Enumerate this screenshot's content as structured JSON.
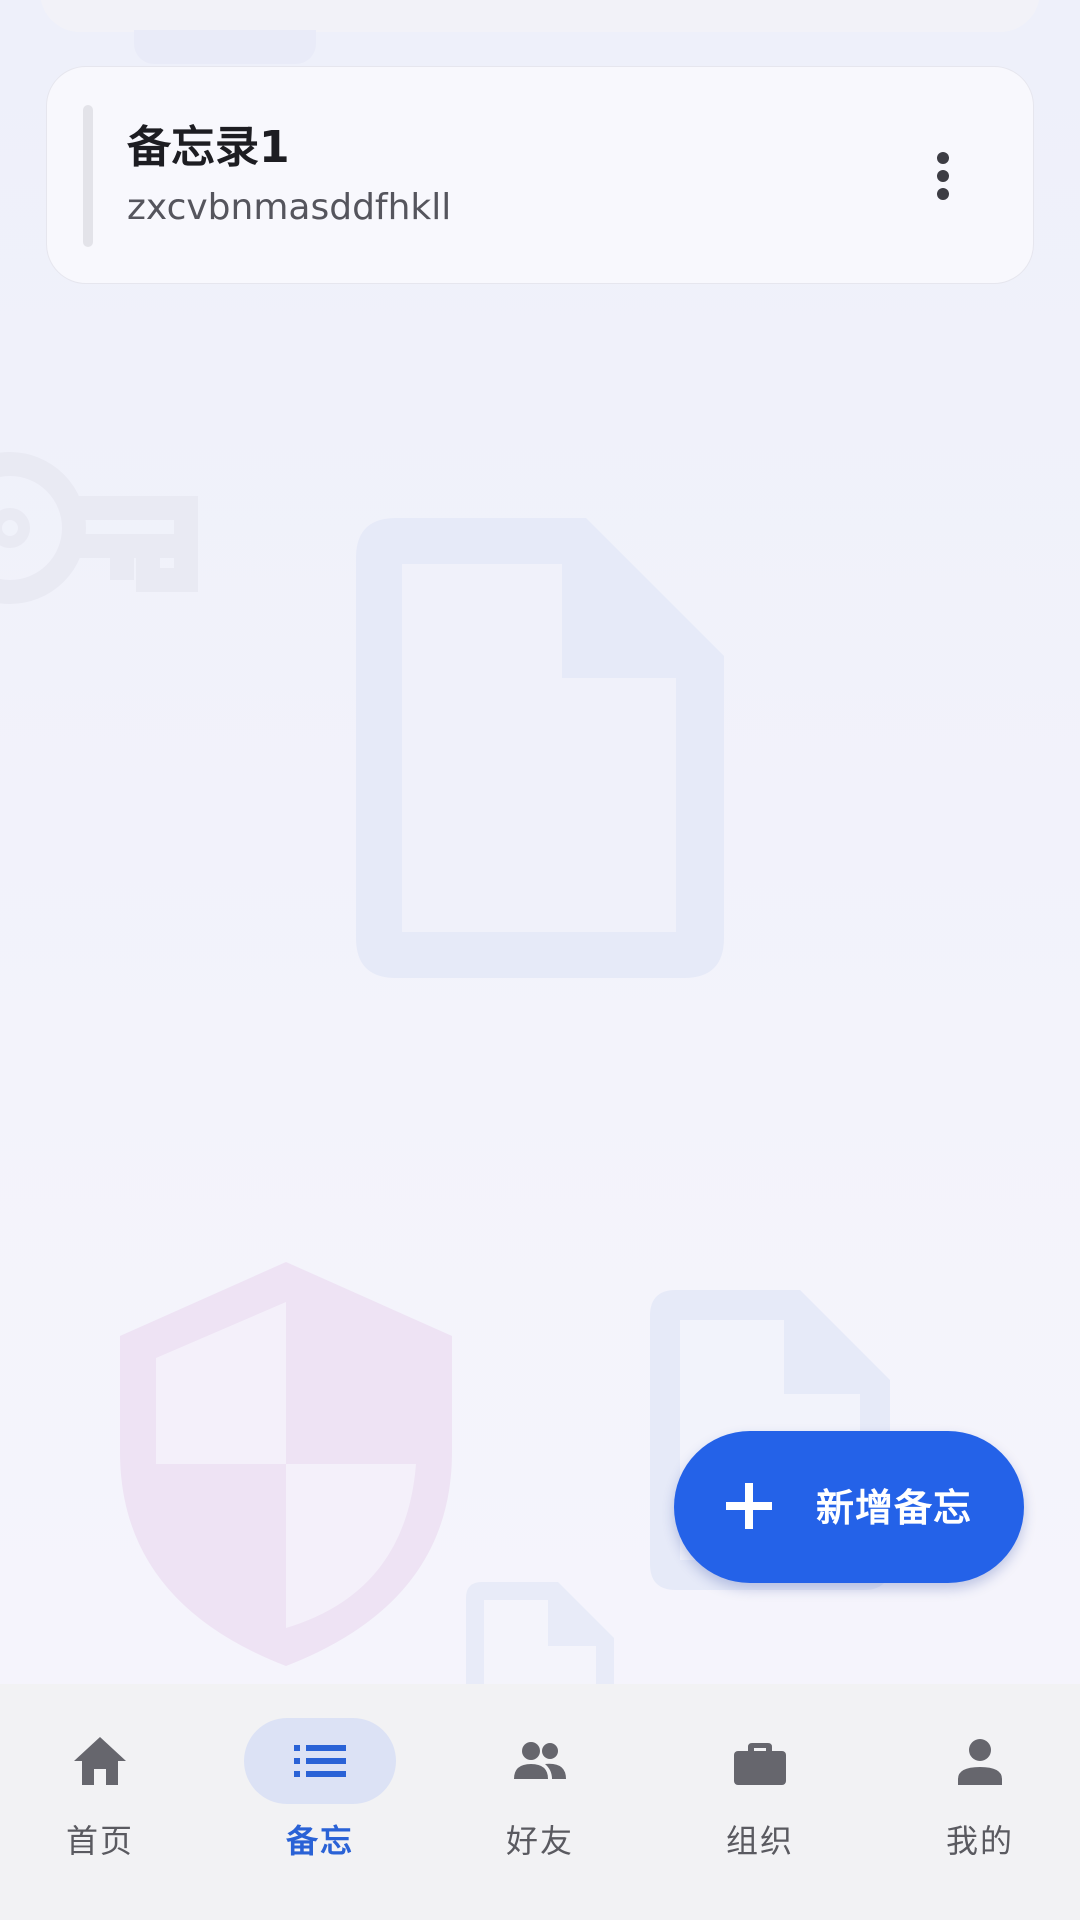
{
  "memo_list": {
    "items": [
      {
        "title": "备忘录1",
        "preview": "zxcvbnmasddfhkll",
        "more_icon": "more-vertical-icon"
      }
    ]
  },
  "fab": {
    "label": "新增备忘",
    "icon": "plus-icon"
  },
  "bottom_nav": {
    "items": [
      {
        "label": "首页",
        "icon": "home-icon",
        "active": false
      },
      {
        "label": "备忘",
        "icon": "list-icon",
        "active": true
      },
      {
        "label": "好友",
        "icon": "people-icon",
        "active": false
      },
      {
        "label": "组织",
        "icon": "briefcase-icon",
        "active": false
      },
      {
        "label": "我的",
        "icon": "person-icon",
        "active": false
      }
    ]
  },
  "colors": {
    "accent": "#2462e8",
    "nav_active": "#2a62d6",
    "nav_active_pill": "#dce2f5",
    "nav_inactive": "#5a5a60"
  }
}
